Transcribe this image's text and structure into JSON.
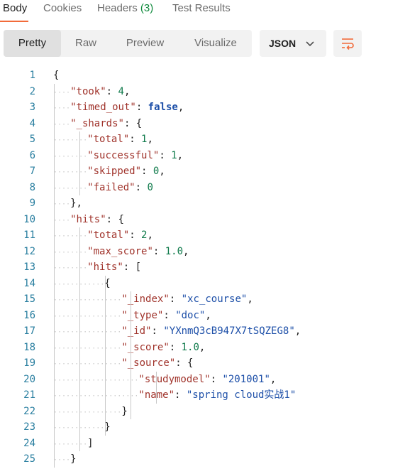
{
  "tabs": [
    {
      "label": "Body"
    },
    {
      "label": "Cookies"
    },
    {
      "label": "Headers",
      "count": "(3)"
    },
    {
      "label": "Test Results"
    }
  ],
  "view_modes": [
    "Pretty",
    "Raw",
    "Preview",
    "Visualize"
  ],
  "format_select": {
    "value": "JSON"
  },
  "code_lines": [
    {
      "n": "1",
      "i": 0,
      "t": [
        [
          "p",
          "{"
        ]
      ]
    },
    {
      "n": "2",
      "i": 1,
      "t": [
        [
          "key",
          "\"took\""
        ],
        [
          "p",
          ": "
        ],
        [
          "num",
          "4"
        ],
        [
          "p",
          ","
        ]
      ]
    },
    {
      "n": "3",
      "i": 1,
      "t": [
        [
          "key",
          "\"timed_out\""
        ],
        [
          "p",
          ": "
        ],
        [
          "kw",
          "false"
        ],
        [
          "p",
          ","
        ]
      ]
    },
    {
      "n": "4",
      "i": 1,
      "t": [
        [
          "key",
          "\"_shards\""
        ],
        [
          "p",
          ": {"
        ]
      ]
    },
    {
      "n": "5",
      "i": 2,
      "t": [
        [
          "key",
          "\"total\""
        ],
        [
          "p",
          ": "
        ],
        [
          "num",
          "1"
        ],
        [
          "p",
          ","
        ]
      ]
    },
    {
      "n": "6",
      "i": 2,
      "t": [
        [
          "key",
          "\"successful\""
        ],
        [
          "p",
          ": "
        ],
        [
          "num",
          "1"
        ],
        [
          "p",
          ","
        ]
      ]
    },
    {
      "n": "7",
      "i": 2,
      "t": [
        [
          "key",
          "\"skipped\""
        ],
        [
          "p",
          ": "
        ],
        [
          "num",
          "0"
        ],
        [
          "p",
          ","
        ]
      ]
    },
    {
      "n": "8",
      "i": 2,
      "t": [
        [
          "key",
          "\"failed\""
        ],
        [
          "p",
          ": "
        ],
        [
          "num",
          "0"
        ]
      ]
    },
    {
      "n": "9",
      "i": 1,
      "t": [
        [
          "p",
          "},"
        ]
      ]
    },
    {
      "n": "10",
      "i": 1,
      "t": [
        [
          "key",
          "\"hits\""
        ],
        [
          "p",
          ": {"
        ]
      ]
    },
    {
      "n": "11",
      "i": 2,
      "t": [
        [
          "key",
          "\"total\""
        ],
        [
          "p",
          ": "
        ],
        [
          "num",
          "2"
        ],
        [
          "p",
          ","
        ]
      ]
    },
    {
      "n": "12",
      "i": 2,
      "t": [
        [
          "key",
          "\"max_score\""
        ],
        [
          "p",
          ": "
        ],
        [
          "num",
          "1.0"
        ],
        [
          "p",
          ","
        ]
      ]
    },
    {
      "n": "13",
      "i": 2,
      "t": [
        [
          "key",
          "\"hits\""
        ],
        [
          "p",
          ": ["
        ]
      ]
    },
    {
      "n": "14",
      "i": 3,
      "t": [
        [
          "p",
          "{"
        ]
      ]
    },
    {
      "n": "15",
      "i": 4,
      "t": [
        [
          "key",
          "\"_index\""
        ],
        [
          "p",
          ": "
        ],
        [
          "str",
          "\"xc_course\""
        ],
        [
          "p",
          ","
        ]
      ]
    },
    {
      "n": "16",
      "i": 4,
      "t": [
        [
          "key",
          "\"_type\""
        ],
        [
          "p",
          ": "
        ],
        [
          "str",
          "\"doc\""
        ],
        [
          "p",
          ","
        ]
      ]
    },
    {
      "n": "17",
      "i": 4,
      "t": [
        [
          "key",
          "\"_id\""
        ],
        [
          "p",
          ": "
        ],
        [
          "str",
          "\"YXnmQ3cB947X7tSQZEG8\""
        ],
        [
          "p",
          ","
        ]
      ]
    },
    {
      "n": "18",
      "i": 4,
      "t": [
        [
          "key",
          "\"_score\""
        ],
        [
          "p",
          ": "
        ],
        [
          "num",
          "1.0"
        ],
        [
          "p",
          ","
        ]
      ]
    },
    {
      "n": "19",
      "i": 4,
      "t": [
        [
          "key",
          "\"_source\""
        ],
        [
          "p",
          ": {"
        ]
      ]
    },
    {
      "n": "20",
      "i": 5,
      "t": [
        [
          "key",
          "\"studymodel\""
        ],
        [
          "p",
          ": "
        ],
        [
          "str",
          "\"201001\""
        ],
        [
          "p",
          ","
        ]
      ]
    },
    {
      "n": "21",
      "i": 5,
      "t": [
        [
          "key",
          "\"name\""
        ],
        [
          "p",
          ": "
        ],
        [
          "str",
          "\"spring cloud实战1\""
        ]
      ]
    },
    {
      "n": "22",
      "i": 4,
      "t": [
        [
          "p",
          "}"
        ]
      ]
    },
    {
      "n": "23",
      "i": 3,
      "t": [
        [
          "p",
          "}"
        ]
      ]
    },
    {
      "n": "24",
      "i": 2,
      "t": [
        [
          "p",
          "]"
        ]
      ]
    },
    {
      "n": "25",
      "i": 1,
      "t": [
        [
          "p",
          "}"
        ]
      ]
    }
  ]
}
